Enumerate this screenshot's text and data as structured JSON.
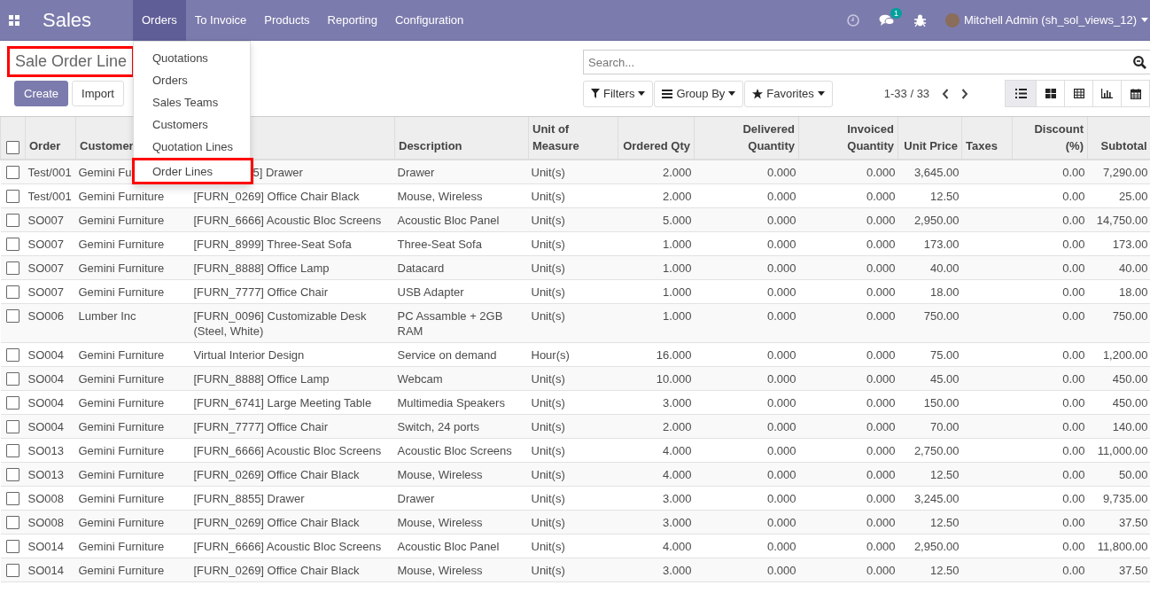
{
  "navbar": {
    "app_name": "Sales",
    "menus": [
      {
        "label": "Orders",
        "selected": true
      },
      {
        "label": "To Invoice",
        "selected": false
      },
      {
        "label": "Products",
        "selected": false
      },
      {
        "label": "Reporting",
        "selected": false
      },
      {
        "label": "Configuration",
        "selected": false
      }
    ],
    "chat_badge": "1",
    "user": "Mitchell Admin (sh_sol_views_12)"
  },
  "orders_menu": {
    "expanded": true,
    "items": [
      {
        "label": "Quotations",
        "highlighted": false
      },
      {
        "label": "Orders",
        "highlighted": false
      },
      {
        "label": "Sales Teams",
        "highlighted": false
      },
      {
        "label": "Customers",
        "highlighted": false
      },
      {
        "label": "Quotation Lines",
        "highlighted": false
      },
      {
        "label": "Order Lines",
        "highlighted": true
      }
    ]
  },
  "control_panel": {
    "title": "Sale Order Line",
    "title_highlighted": true,
    "buttons": [
      {
        "label": "Create",
        "kind": "primary"
      },
      {
        "label": "Import",
        "kind": "secondary"
      }
    ],
    "search_placeholder": "Search...",
    "filters": [
      "Filters",
      "Group By",
      "Favorites"
    ],
    "pager": "1-33 / 33",
    "views": [
      {
        "kind": "list",
        "selected": true
      },
      {
        "kind": "kanban",
        "selected": false
      },
      {
        "kind": "pivot",
        "selected": false
      },
      {
        "kind": "graph",
        "selected": false
      },
      {
        "kind": "calendar",
        "selected": false
      }
    ]
  },
  "table": {
    "select_all_checked": false,
    "columns": [
      {
        "label": "Order"
      },
      {
        "label": "Customer"
      },
      {},
      {
        "label": "Description"
      },
      {
        "label": "Unit of Measure"
      },
      {
        "label": "Ordered Qty"
      },
      {
        "label": "Delivered Quantity"
      },
      {
        "label": "Invoiced Quantity"
      },
      {
        "label": "Unit Price"
      },
      {
        "label": "Taxes"
      },
      {
        "label": "Discount (%)"
      },
      {
        "label": "Subtotal"
      }
    ],
    "rows": [
      {
        "checked": false,
        "covered": true,
        "order": "Test/001",
        "customer": "Gemini Fu",
        "product": "5] Drawer",
        "description": "Drawer",
        "uom": "Unit(s)",
        "ordered": "2.000",
        "delivered": "0.000",
        "invoiced": "0.000",
        "price": "3,645.00",
        "discount": "0.00",
        "subtotal": "7,290.00"
      },
      {
        "checked": false,
        "covered": false,
        "order": "Test/001",
        "customer": "Gemini Furniture",
        "product": "[FURN_0269] Office Chair Black",
        "description": "Mouse, Wireless",
        "uom": "Unit(s)",
        "ordered": "2.000",
        "delivered": "0.000",
        "invoiced": "0.000",
        "price": "12.50",
        "discount": "0.00",
        "subtotal": "25.00"
      },
      {
        "checked": false,
        "covered": false,
        "order": "SO007",
        "customer": "Gemini Furniture",
        "product": "[FURN_6666] Acoustic Bloc Screens",
        "description": "Acoustic Bloc Panel",
        "uom": "Unit(s)",
        "ordered": "5.000",
        "delivered": "0.000",
        "invoiced": "0.000",
        "price": "2,950.00",
        "discount": "0.00",
        "subtotal": "14,750.00"
      },
      {
        "checked": false,
        "covered": false,
        "order": "SO007",
        "customer": "Gemini Furniture",
        "product": "[FURN_8999] Three-Seat Sofa",
        "description": "Three-Seat Sofa",
        "uom": "Unit(s)",
        "ordered": "1.000",
        "delivered": "0.000",
        "invoiced": "0.000",
        "price": "173.00",
        "discount": "0.00",
        "subtotal": "173.00"
      },
      {
        "checked": false,
        "covered": false,
        "order": "SO007",
        "customer": "Gemini Furniture",
        "product": "[FURN_8888] Office Lamp",
        "description": "Datacard",
        "uom": "Unit(s)",
        "ordered": "1.000",
        "delivered": "0.000",
        "invoiced": "0.000",
        "price": "40.00",
        "discount": "0.00",
        "subtotal": "40.00"
      },
      {
        "checked": false,
        "covered": false,
        "order": "SO007",
        "customer": "Gemini Furniture",
        "product": "[FURN_7777] Office Chair",
        "description": "USB Adapter",
        "uom": "Unit(s)",
        "ordered": "1.000",
        "delivered": "0.000",
        "invoiced": "0.000",
        "price": "18.00",
        "discount": "0.00",
        "subtotal": "18.00"
      },
      {
        "checked": false,
        "covered": false,
        "order": "SO006",
        "customer": "Lumber Inc",
        "product": "[FURN_0096] Customizable Desk (Steel, White)",
        "description": "PC Assamble + 2GB RAM",
        "uom": "Unit(s)",
        "ordered": "1.000",
        "delivered": "0.000",
        "invoiced": "0.000",
        "price": "750.00",
        "discount": "0.00",
        "subtotal": "750.00"
      },
      {
        "checked": false,
        "covered": false,
        "order": "SO004",
        "customer": "Gemini Furniture",
        "product": "Virtual Interior Design",
        "description": "Service on demand",
        "uom": "Hour(s)",
        "ordered": "16.000",
        "delivered": "0.000",
        "invoiced": "0.000",
        "price": "75.00",
        "discount": "0.00",
        "subtotal": "1,200.00"
      },
      {
        "checked": false,
        "covered": false,
        "order": "SO004",
        "customer": "Gemini Furniture",
        "product": "[FURN_8888] Office Lamp",
        "description": "Webcam",
        "uom": "Unit(s)",
        "ordered": "10.000",
        "delivered": "0.000",
        "invoiced": "0.000",
        "price": "45.00",
        "discount": "0.00",
        "subtotal": "450.00"
      },
      {
        "checked": false,
        "covered": false,
        "order": "SO004",
        "customer": "Gemini Furniture",
        "product": "[FURN_6741] Large Meeting Table",
        "description": "Multimedia Speakers",
        "uom": "Unit(s)",
        "ordered": "3.000",
        "delivered": "0.000",
        "invoiced": "0.000",
        "price": "150.00",
        "discount": "0.00",
        "subtotal": "450.00"
      },
      {
        "checked": false,
        "covered": false,
        "order": "SO004",
        "customer": "Gemini Furniture",
        "product": "[FURN_7777] Office Chair",
        "description": "Switch, 24 ports",
        "uom": "Unit(s)",
        "ordered": "2.000",
        "delivered": "0.000",
        "invoiced": "0.000",
        "price": "70.00",
        "discount": "0.00",
        "subtotal": "140.00"
      },
      {
        "checked": false,
        "covered": false,
        "order": "SO013",
        "customer": "Gemini Furniture",
        "product": "[FURN_6666] Acoustic Bloc Screens",
        "description": "Acoustic Bloc Screens",
        "uom": "Unit(s)",
        "ordered": "4.000",
        "delivered": "0.000",
        "invoiced": "0.000",
        "price": "2,750.00",
        "discount": "0.00",
        "subtotal": "11,000.00"
      },
      {
        "checked": false,
        "covered": false,
        "order": "SO013",
        "customer": "Gemini Furniture",
        "product": "[FURN_0269] Office Chair Black",
        "description": "Mouse, Wireless",
        "uom": "Unit(s)",
        "ordered": "4.000",
        "delivered": "0.000",
        "invoiced": "0.000",
        "price": "12.50",
        "discount": "0.00",
        "subtotal": "50.00"
      },
      {
        "checked": false,
        "covered": false,
        "order": "SO008",
        "customer": "Gemini Furniture",
        "product": "[FURN_8855] Drawer",
        "description": "Drawer",
        "uom": "Unit(s)",
        "ordered": "3.000",
        "delivered": "0.000",
        "invoiced": "0.000",
        "price": "3,245.00",
        "discount": "0.00",
        "subtotal": "9,735.00"
      },
      {
        "checked": false,
        "covered": false,
        "order": "SO008",
        "customer": "Gemini Furniture",
        "product": "[FURN_0269] Office Chair Black",
        "description": "Mouse, Wireless",
        "uom": "Unit(s)",
        "ordered": "3.000",
        "delivered": "0.000",
        "invoiced": "0.000",
        "price": "12.50",
        "discount": "0.00",
        "subtotal": "37.50"
      },
      {
        "checked": false,
        "covered": false,
        "order": "SO014",
        "customer": "Gemini Furniture",
        "product": "[FURN_6666] Acoustic Bloc Screens",
        "description": "Acoustic Bloc Panel",
        "uom": "Unit(s)",
        "ordered": "4.000",
        "delivered": "0.000",
        "invoiced": "0.000",
        "price": "2,950.00",
        "discount": "0.00",
        "subtotal": "11,800.00"
      },
      {
        "checked": false,
        "covered": false,
        "order": "SO014",
        "customer": "Gemini Furniture",
        "product": "[FURN_0269] Office Chair Black",
        "description": "Mouse, Wireless",
        "uom": "Unit(s)",
        "ordered": "3.000",
        "delivered": "0.000",
        "invoiced": "0.000",
        "price": "12.50",
        "discount": "0.00",
        "subtotal": "37.50"
      }
    ]
  }
}
